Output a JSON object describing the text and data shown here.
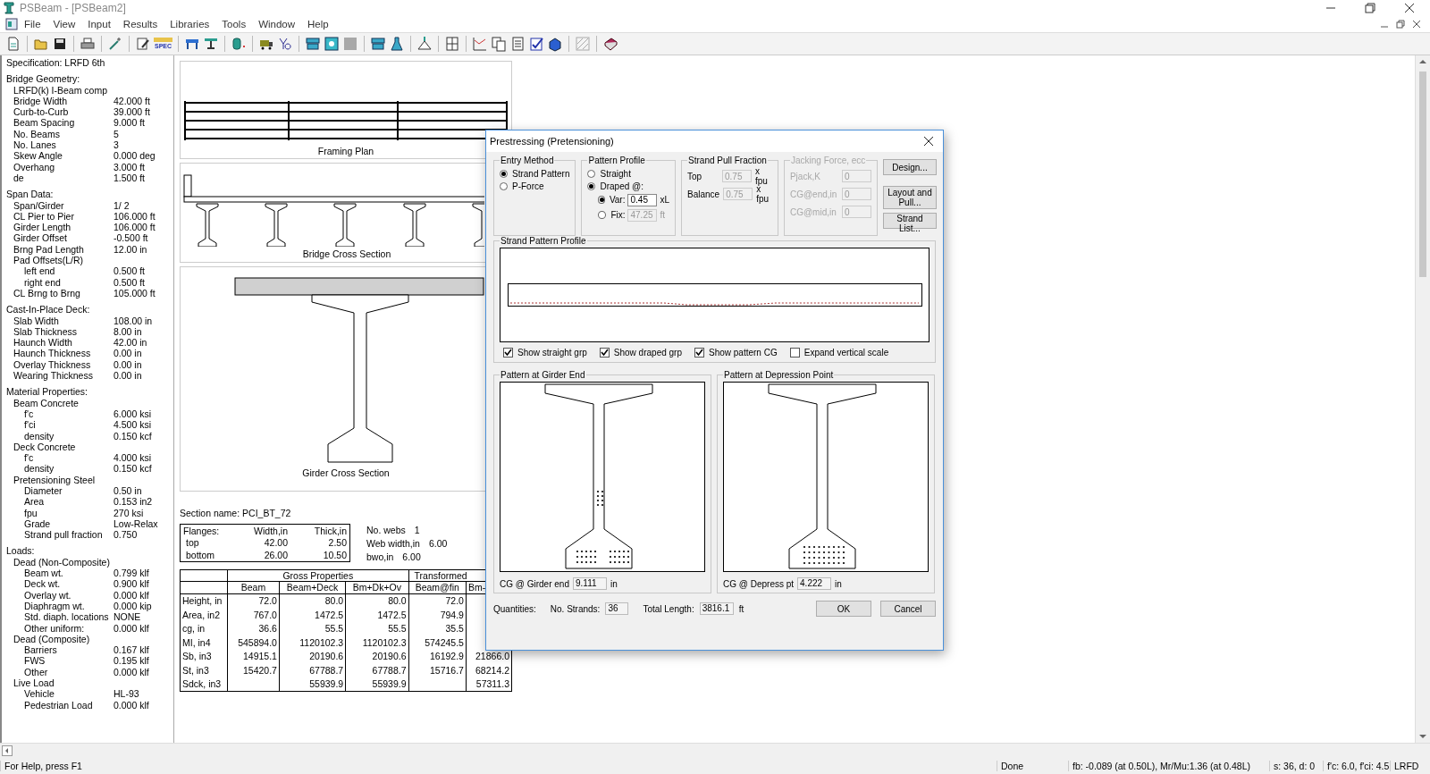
{
  "window": {
    "title": "PSBeam - [PSBeam2]"
  },
  "menu": [
    "File",
    "View",
    "Input",
    "Results",
    "Libraries",
    "Tools",
    "Window",
    "Help"
  ],
  "toolbar": [
    [
      {
        "kind": "doc"
      }
    ],
    [
      {
        "kind": "folder"
      },
      {
        "kind": "disk"
      }
    ],
    [
      {
        "kind": "printer"
      }
    ],
    [
      {
        "kind": "wand"
      }
    ],
    [
      {
        "kind": "pencil"
      },
      {
        "kind": "spec",
        "label": "SPEC"
      }
    ],
    [
      {
        "kind": "frame"
      },
      {
        "kind": "stand"
      }
    ],
    [
      {
        "kind": "cylinder"
      }
    ],
    [
      {
        "kind": "truck"
      },
      {
        "kind": "greek"
      }
    ],
    [
      {
        "kind": "beam"
      },
      {
        "kind": "map"
      },
      {
        "kind": "blank"
      }
    ],
    [
      {
        "kind": "beam"
      },
      {
        "kind": "flask"
      }
    ],
    [
      {
        "kind": "lift"
      }
    ],
    [
      {
        "kind": "digits"
      }
    ],
    [
      {
        "kind": "graph"
      },
      {
        "kind": "copies"
      },
      {
        "kind": "pages"
      },
      {
        "kind": "check"
      },
      {
        "kind": "cube"
      }
    ],
    [
      {
        "kind": "hatch"
      }
    ],
    [
      {
        "kind": "book"
      }
    ]
  ],
  "specification": "Specification: LRFD 6th",
  "sections": [
    {
      "title": "Bridge Geometry:",
      "items": [
        {
          "label": "LRFD(k) I-Beam comp"
        },
        {
          "label": "Bridge Width",
          "value": "42.000 ft"
        },
        {
          "label": "Curb-to-Curb",
          "value": "39.000 ft"
        },
        {
          "label": "Beam Spacing",
          "value": "9.000 ft"
        },
        {
          "label": "No. Beams",
          "value": "5"
        },
        {
          "label": "No. Lanes",
          "value": "3"
        },
        {
          "label": "Skew Angle",
          "value": "0.000 deg"
        },
        {
          "label": "Overhang",
          "value": "3.000 ft"
        },
        {
          "label": "de",
          "value": "1.500 ft"
        }
      ]
    },
    {
      "title": "Span Data:",
      "items": [
        {
          "label": "Span/Girder",
          "value": "1/ 2"
        },
        {
          "label": "CL Pier to Pier",
          "value": "106.000 ft"
        },
        {
          "label": "Girder Length",
          "value": "106.000 ft"
        },
        {
          "label": "Girder Offset",
          "value": "-0.500 ft"
        },
        {
          "label": "Brng Pad Length",
          "value": "12.00 in"
        },
        {
          "label": "Pad Offsets(L/R)",
          "children": [
            {
              "label": "left end",
              "value": "0.500 ft"
            },
            {
              "label": "right end",
              "value": "0.500 ft"
            }
          ]
        },
        {
          "label": "CL Brng to Brng",
          "value": "105.000 ft"
        }
      ]
    },
    {
      "title": "Cast-In-Place Deck:",
      "items": [
        {
          "label": "Slab Width",
          "value": "108.00 in"
        },
        {
          "label": "Slab Thickness",
          "value": "8.00 in"
        },
        {
          "label": "Haunch Width",
          "value": "42.00 in"
        },
        {
          "label": "Haunch Thickness",
          "value": "0.00 in"
        },
        {
          "label": "Overlay Thickness",
          "value": "0.00 in"
        },
        {
          "label": "Wearing Thickness",
          "value": "0.00 in"
        }
      ]
    },
    {
      "title": "Material Properties:",
      "items": [
        {
          "label": "Beam Concrete",
          "children": [
            {
              "label": "f'c",
              "value": "6.000 ksi"
            },
            {
              "label": "f'ci",
              "value": "4.500 ksi"
            },
            {
              "label": "density",
              "value": "0.150 kcf"
            }
          ]
        },
        {
          "label": "Deck Concrete",
          "children": [
            {
              "label": "f'c",
              "value": "4.000 ksi"
            },
            {
              "label": "density",
              "value": "0.150 kcf"
            }
          ]
        },
        {
          "label": "Pretensioning Steel",
          "children": [
            {
              "label": "Diameter",
              "value": "0.50 in"
            },
            {
              "label": "Area",
              "value": "0.153 in2"
            },
            {
              "label": "fpu",
              "value": "270 ksi"
            },
            {
              "label": "Grade",
              "value": "Low-Relax"
            },
            {
              "label": "Strand pull fraction",
              "value": "0.750"
            }
          ]
        }
      ]
    },
    {
      "title": "Loads:",
      "items": [
        {
          "label": "Dead (Non-Composite)",
          "children": [
            {
              "label": "Beam wt.",
              "value": "0.799 klf"
            },
            {
              "label": "Deck wt.",
              "value": "0.900 klf"
            },
            {
              "label": "Overlay wt.",
              "value": "0.000 klf"
            },
            {
              "label": "Diaphragm wt.",
              "value": "0.000 kip"
            },
            {
              "label": "Std. diaph. locations",
              "value": "NONE"
            },
            {
              "label": "Other uniform:",
              "value": "0.000 klf"
            }
          ]
        },
        {
          "label": "Dead (Composite)",
          "children": [
            {
              "label": "Barriers",
              "value": "0.167 klf"
            },
            {
              "label": "FWS",
              "value": "0.195 klf"
            },
            {
              "label": "Other",
              "value": "0.000 klf"
            }
          ]
        },
        {
          "label": "Live Load",
          "children": [
            {
              "label": "Vehicle",
              "value": "HL-93"
            },
            {
              "label": "Pedestrian Load",
              "value": "0.000 klf"
            }
          ]
        }
      ]
    }
  ],
  "drawings": {
    "framing_plan": "Framing Plan",
    "bridge_section": "Bridge Cross Section",
    "girder_section": "Girder Cross Section"
  },
  "section_name": "Section name: PCI_BT_72",
  "flanges": {
    "columns": [
      "Flanges:",
      "Width,in",
      "Thick,in"
    ],
    "rows": [
      [
        "top",
        "42.00",
        "2.50"
      ],
      [
        "bottom",
        "26.00",
        "10.50"
      ]
    ]
  },
  "web_info": [
    {
      "label": "No. webs",
      "value": "1"
    },
    {
      "label": "Web width,in",
      "value": "6.00"
    },
    {
      "label": "bwo,in",
      "value": "6.00"
    }
  ],
  "properties": {
    "groups": [
      "Gross Properties",
      "Transformed"
    ],
    "columns": [
      "",
      "Beam",
      "Beam+Deck",
      "Bm+Dk+Ov",
      "Beam@fin",
      "Bm-"
    ],
    "rows": [
      [
        "Height, in",
        "72.0",
        "80.0",
        "80.0",
        "72.0",
        null
      ],
      [
        "Area, in2",
        "767.0",
        "1472.5",
        "1472.5",
        "794.9",
        null
      ],
      [
        "cg, in",
        "36.6",
        "55.5",
        "55.5",
        "35.5",
        null
      ],
      [
        "MI, in4",
        "545894.0",
        "1120102.3",
        "1120102.3",
        "574245.5",
        null
      ],
      [
        "Sb, in3",
        "14915.1",
        "20190.6",
        "20190.6",
        "16192.9",
        "21866.0"
      ],
      [
        "St, in3",
        "15420.7",
        "67788.7",
        "67788.7",
        "15716.7",
        "68214.2"
      ],
      [
        "Sdck, in3",
        null,
        "55939.9",
        "55939.9",
        null,
        "57311.3"
      ]
    ]
  },
  "dialog": {
    "title": "Prestressing  (Pretensioning)",
    "entry_method": {
      "label": "Entry Method",
      "options": [
        {
          "label": "Strand Pattern",
          "selected": true
        },
        {
          "label": "P-Force",
          "selected": false
        }
      ]
    },
    "pattern_profile": {
      "label": "Pattern  Profile",
      "options": [
        {
          "label": "Straight",
          "selected": false
        },
        {
          "label": "Draped @:",
          "selected": true
        }
      ],
      "draped": [
        {
          "label": "Var:",
          "selected": true,
          "value": "0.45",
          "unit": "xL",
          "disabled": false
        },
        {
          "label": "Fix:",
          "selected": false,
          "value": "47.25",
          "unit": "ft",
          "disabled": true
        }
      ]
    },
    "pull_fraction": {
      "label": "Strand Pull Fraction",
      "rows": [
        {
          "label": "Top",
          "value": "0.75",
          "unit": "x fpu",
          "disabled": true
        },
        {
          "label": "Balance",
          "value": "0.75",
          "unit": "x fpu",
          "disabled": true
        }
      ]
    },
    "jacking": {
      "label": "Jacking Force, ecc",
      "disabled": true,
      "rows": [
        {
          "label": "Pjack,K",
          "value": "0"
        },
        {
          "label": "CG@end,in",
          "value": "0"
        },
        {
          "label": "CG@mid,in",
          "value": "0"
        }
      ]
    },
    "buttons": [
      "Design...",
      "Layout and Pull...",
      "Strand List..."
    ],
    "profile": {
      "label": "Strand Pattern Profile",
      "checks": [
        {
          "label": "Show straight grp",
          "checked": true
        },
        {
          "label": "Show draped grp",
          "checked": true
        },
        {
          "label": "Show pattern CG",
          "checked": true
        },
        {
          "label": "Expand vertical scale",
          "checked": false
        }
      ]
    },
    "patterns": [
      {
        "kind": "end",
        "label": "Pattern at Girder End",
        "cg_label": "CG @ Girder end",
        "cg_value": "9.111",
        "unit": "in"
      },
      {
        "kind": "depression",
        "label": "Pattern at Depression Point",
        "cg_label": "CG @ Depress pt",
        "cg_value": "4.222",
        "unit": "in"
      }
    ],
    "quantities": {
      "label": "Quantities:",
      "strands_label": "No. Strands:",
      "strands": "36",
      "length_label": "Total Length:",
      "length": "3816.1",
      "unit": "ft"
    },
    "actions": [
      "OK",
      "Cancel"
    ]
  },
  "status_bar": [
    "For Help, press F1",
    "Done",
    "fb: -0.089 (at 0.50L), Mr/Mu:1.36 (at 0.48L)",
    "s: 36, d:  0",
    "f'c: 6.0, f'ci: 4.5",
    "LRFD"
  ]
}
